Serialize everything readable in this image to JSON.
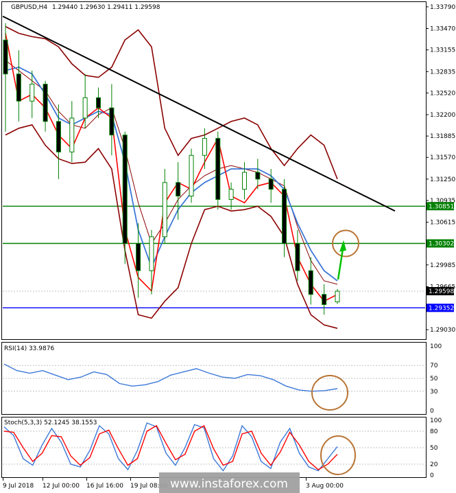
{
  "header": {
    "symbol": "GBPUSD,H4",
    "ohlc": "1.29440 1.29630 1.29411 1.29598"
  },
  "colors": {
    "candle": "#008000",
    "bollinger": "#8b0000",
    "ma_fast": "#ff0000",
    "ma_slow": "#3c78d8",
    "trendline": "#000000",
    "support_green": "#008000",
    "support_blue": "#0000ff",
    "circle": "#b87333",
    "arrow": "#00c000",
    "rsi_line": "#3c78d8",
    "stoch_main": "#3c78d8",
    "stoch_signal": "#ff0000",
    "watermark_bg": "#a0a0a0"
  },
  "chart_data": [
    {
      "type": "candlestick",
      "title": "GBPUSD,H4",
      "ylim": [
        1.289,
        1.3385
      ],
      "y_ticks": [
        "1.33790",
        "1.33470",
        "1.33155",
        "1.32835",
        "1.32520",
        "1.32200",
        "1.31885",
        "1.31570",
        "1.31250",
        "1.30935",
        "1.30615",
        "1.29985",
        "1.29665",
        "1.29030"
      ],
      "price_labels": [
        {
          "label": "1.30851",
          "value": 1.30851,
          "role": "resistance-line"
        },
        {
          "label": "1.30302",
          "value": 1.30302,
          "role": "resistance-line"
        },
        {
          "label": "1.29598",
          "value": 1.29598,
          "role": "current-price"
        },
        {
          "label": "1.29352",
          "value": 1.29352,
          "role": "support-line"
        }
      ],
      "x_labels": [
        "9 Jul 2018",
        "12 Jul 00:00",
        "16 Jul 16:00",
        "19 Jul 08:00",
        "3 Aug 00:00"
      ],
      "indicators": [
        "Bollinger Bands",
        "Moving Average (fast)",
        "Moving Average (slow)"
      ],
      "trendline": {
        "from": 1.3365,
        "to": 1.3078
      },
      "bollinger_upper": [
        1.335,
        1.334,
        1.3335,
        1.3332,
        1.332,
        1.3295,
        1.3278,
        1.3275,
        1.329,
        1.333,
        1.3345,
        1.332,
        1.32,
        1.316,
        1.3185,
        1.319,
        1.32,
        1.321,
        1.3215,
        1.3205,
        1.317,
        1.3145,
        1.317,
        1.319,
        1.3175,
        1.3125
      ],
      "bollinger_mid": [
        1.33,
        1.3285,
        1.327,
        1.3255,
        1.3225,
        1.3205,
        1.32,
        1.322,
        1.323,
        1.317,
        1.309,
        1.303,
        1.306,
        1.3095,
        1.3115,
        1.313,
        1.314,
        1.3145,
        1.314,
        1.3135,
        1.3125,
        1.3115,
        1.3055,
        1.3005,
        1.2975,
        1.297
      ],
      "bollinger_lower": [
        1.319,
        1.32,
        1.3205,
        1.3175,
        1.3155,
        1.3148,
        1.315,
        1.317,
        1.314,
        1.302,
        1.2925,
        1.292,
        1.2945,
        1.2965,
        1.303,
        1.308,
        1.3085,
        1.3078,
        1.308,
        1.3085,
        1.307,
        1.304,
        1.297,
        1.2925,
        1.291,
        1.2905
      ],
      "ma_fast": [
        1.334,
        1.324,
        1.325,
        1.323,
        1.319,
        1.317,
        1.3215,
        1.323,
        1.3215,
        1.305,
        1.298,
        1.296,
        1.309,
        1.312,
        1.311,
        1.315,
        1.3185,
        1.31,
        1.309,
        1.3115,
        1.312,
        1.31,
        1.301,
        1.297,
        1.2945,
        1.2955
      ],
      "ma_slow": [
        1.3285,
        1.329,
        1.328,
        1.325,
        1.3215,
        1.3205,
        1.3215,
        1.3225,
        1.322,
        1.315,
        1.305,
        1.2995,
        1.304,
        1.308,
        1.3105,
        1.312,
        1.313,
        1.314,
        1.314,
        1.314,
        1.313,
        1.311,
        1.306,
        1.302,
        1.299,
        1.2975
      ],
      "candles": [
        {
          "o": 1.333,
          "h": 1.3355,
          "l": 1.3195,
          "c": 1.328
        },
        {
          "o": 1.328,
          "h": 1.3315,
          "l": 1.321,
          "c": 1.324
        },
        {
          "o": 1.324,
          "h": 1.3285,
          "l": 1.3215,
          "c": 1.3265
        },
        {
          "o": 1.3265,
          "h": 1.327,
          "l": 1.3195,
          "c": 1.321
        },
        {
          "o": 1.321,
          "h": 1.3235,
          "l": 1.3125,
          "c": 1.3165
        },
        {
          "o": 1.3165,
          "h": 1.324,
          "l": 1.315,
          "c": 1.3215
        },
        {
          "o": 1.3215,
          "h": 1.328,
          "l": 1.32,
          "c": 1.3245
        },
        {
          "o": 1.3245,
          "h": 1.326,
          "l": 1.3215,
          "c": 1.323
        },
        {
          "o": 1.323,
          "h": 1.3265,
          "l": 1.316,
          "c": 1.319
        },
        {
          "o": 1.319,
          "h": 1.3195,
          "l": 1.3,
          "c": 1.303
        },
        {
          "o": 1.303,
          "h": 1.306,
          "l": 1.295,
          "c": 1.299
        },
        {
          "o": 1.299,
          "h": 1.305,
          "l": 1.2955,
          "c": 1.304
        },
        {
          "o": 1.304,
          "h": 1.314,
          "l": 1.303,
          "c": 1.312
        },
        {
          "o": 1.312,
          "h": 1.315,
          "l": 1.3065,
          "c": 1.31
        },
        {
          "o": 1.31,
          "h": 1.317,
          "l": 1.309,
          "c": 1.316
        },
        {
          "o": 1.316,
          "h": 1.32,
          "l": 1.314,
          "c": 1.3185
        },
        {
          "o": 1.3185,
          "h": 1.3195,
          "l": 1.308,
          "c": 1.3095
        },
        {
          "o": 1.3095,
          "h": 1.312,
          "l": 1.308,
          "c": 1.311
        },
        {
          "o": 1.311,
          "h": 1.315,
          "l": 1.3095,
          "c": 1.3135
        },
        {
          "o": 1.3135,
          "h": 1.3155,
          "l": 1.311,
          "c": 1.3125
        },
        {
          "o": 1.3125,
          "h": 1.314,
          "l": 1.309,
          "c": 1.311
        },
        {
          "o": 1.311,
          "h": 1.3125,
          "l": 1.301,
          "c": 1.303
        },
        {
          "o": 1.303,
          "h": 1.305,
          "l": 1.2975,
          "c": 1.299
        },
        {
          "o": 1.299,
          "h": 1.301,
          "l": 1.294,
          "c": 1.2955
        },
        {
          "o": 1.2955,
          "h": 1.297,
          "l": 1.2925,
          "c": 1.294
        },
        {
          "o": 1.2944,
          "h": 1.2963,
          "l": 1.2941,
          "c": 1.29598
        }
      ]
    },
    {
      "type": "line",
      "title": "RSI(14) 33.9876",
      "ylim": [
        0,
        100
      ],
      "y_ticks": [
        "100",
        "70",
        "50",
        "30",
        "0"
      ],
      "levels": [
        70,
        50,
        30
      ],
      "series": [
        {
          "name": "RSI(14)",
          "values": [
            72,
            62,
            58,
            62,
            55,
            48,
            52,
            60,
            56,
            42,
            38,
            40,
            45,
            55,
            60,
            65,
            58,
            52,
            50,
            56,
            54,
            48,
            38,
            32,
            30,
            31,
            34
          ]
        }
      ]
    },
    {
      "type": "line",
      "title": "Stoch(5,3,3) 52.1245 38.1553",
      "ylim": [
        0,
        100
      ],
      "y_ticks": [
        "100",
        "80",
        "50",
        "20",
        "0"
      ],
      "levels": [
        80,
        50,
        20
      ],
      "series": [
        {
          "name": "Stoch main",
          "values": [
            88,
            72,
            30,
            18,
            55,
            85,
            60,
            20,
            15,
            45,
            90,
            75,
            30,
            10,
            45,
            95,
            88,
            40,
            18,
            50,
            92,
            86,
            30,
            8,
            35,
            90,
            70,
            25,
            12,
            60,
            85,
            40,
            15,
            8,
            30,
            52
          ]
        },
        {
          "name": "Stoch signal",
          "values": [
            80,
            78,
            50,
            25,
            40,
            72,
            70,
            35,
            18,
            32,
            75,
            82,
            48,
            18,
            30,
            80,
            90,
            58,
            28,
            38,
            80,
            90,
            48,
            18,
            25,
            75,
            80,
            40,
            18,
            42,
            78,
            55,
            25,
            10,
            20,
            38
          ]
        }
      ]
    }
  ],
  "watermark": {
    "text": "www.instaforex.com"
  }
}
